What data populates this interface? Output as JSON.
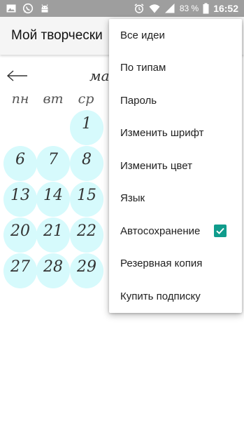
{
  "status_bar": {
    "battery_percent": "83 %",
    "time": "16:52",
    "icons": [
      "image-icon",
      "whatsapp-icon",
      "android-icon",
      "alarm-icon",
      "wifi-icon",
      "cell-signal-icon",
      "battery-icon"
    ]
  },
  "app_bar": {
    "title": "Мой творчески"
  },
  "calendar": {
    "back_icon": "arrow-left-icon",
    "month_partial": "ма",
    "weekdays": [
      "пн",
      "вт",
      "ср"
    ],
    "rows": [
      [
        "",
        "",
        "1"
      ],
      [
        "6",
        "7",
        "8"
      ],
      [
        "13",
        "14",
        "15"
      ],
      [
        "20",
        "21",
        "22"
      ],
      [
        "27",
        "28",
        "29"
      ]
    ]
  },
  "menu": {
    "items": [
      {
        "label": "Все идеи"
      },
      {
        "label": "По типам"
      },
      {
        "label": "Пароль"
      },
      {
        "label": "Изменить шрифт"
      },
      {
        "label": "Изменить цвет"
      },
      {
        "label": "Язык"
      },
      {
        "label": "Автосохранение",
        "checked": true
      },
      {
        "label": "Резервная копия"
      },
      {
        "label": "Купить подписку"
      }
    ],
    "checkbox_color": "#109c8c"
  },
  "colors": {
    "status_bar": "#9e9e9e",
    "app_bar": "#f5f5f5",
    "day_circle": "#d6fafc"
  }
}
